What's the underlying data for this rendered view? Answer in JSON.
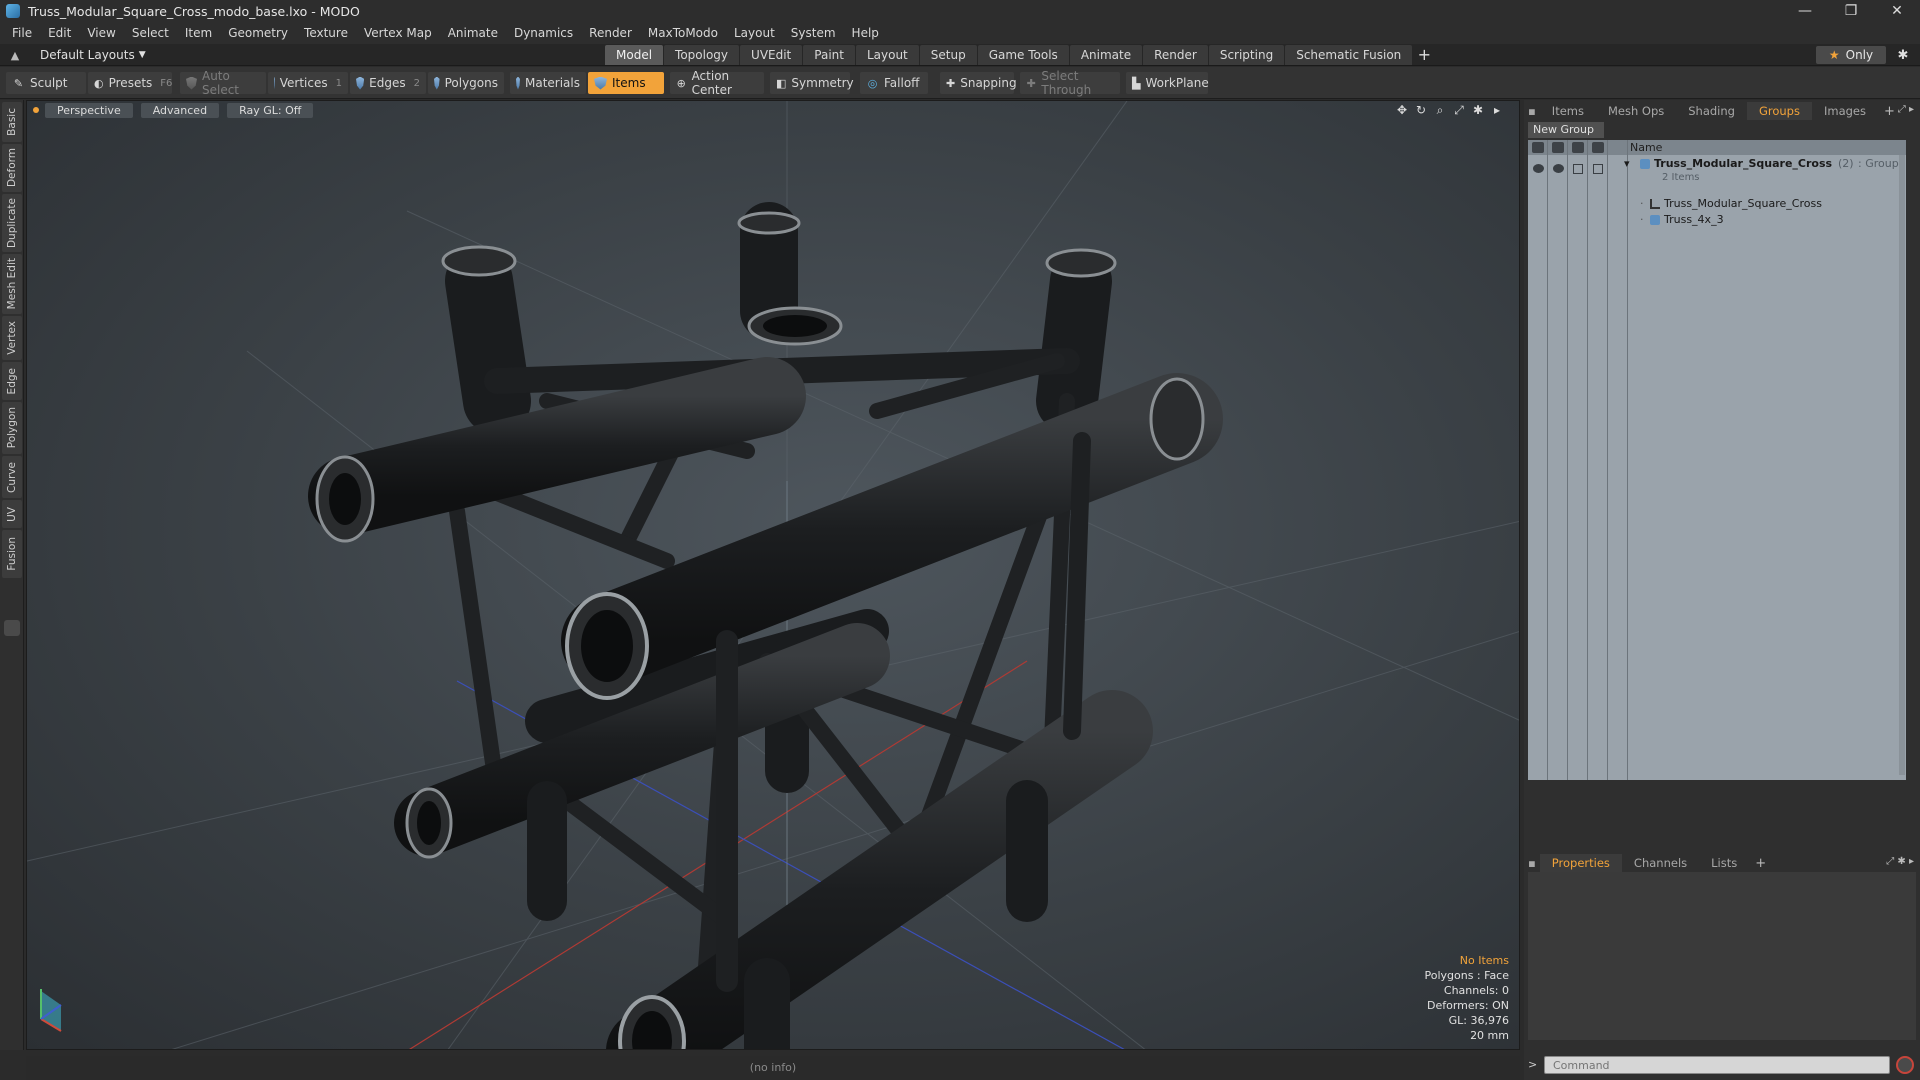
{
  "window": {
    "title": "Truss_Modular_Square_Cross_modo_base.lxo - MODO",
    "minimize": "—",
    "restore": "❐",
    "close": "✕"
  },
  "menu": [
    "File",
    "Edit",
    "View",
    "Select",
    "Item",
    "Geometry",
    "Texture",
    "Vertex Map",
    "Animate",
    "Dynamics",
    "Render",
    "MaxToModo",
    "Layout",
    "System",
    "Help"
  ],
  "layoutbar": {
    "layout_name": "Default Layouts",
    "tabs": [
      {
        "label": "Model",
        "active": true
      },
      {
        "label": "Topology",
        "active": false
      },
      {
        "label": "UVEdit",
        "active": false
      },
      {
        "label": "Paint",
        "active": false
      },
      {
        "label": "Layout",
        "active": false
      },
      {
        "label": "Setup",
        "active": false
      },
      {
        "label": "Game Tools",
        "active": false
      },
      {
        "label": "Animate",
        "active": false
      },
      {
        "label": "Render",
        "active": false
      },
      {
        "label": "Scripting",
        "active": false
      },
      {
        "label": "Schematic Fusion",
        "active": false
      }
    ],
    "only_label": "Only"
  },
  "toolbar": {
    "sculpt": "Sculpt",
    "presets": "Presets",
    "presets_key": "F6",
    "auto_select": "Auto Select",
    "vertices": "Vertices",
    "vertices_key": "1",
    "edges": "Edges",
    "edges_key": "2",
    "polygons": "Polygons",
    "materials": "Materials",
    "items": "Items",
    "action_center": "Action Center",
    "symmetry": "Symmetry",
    "falloff": "Falloff",
    "snapping": "Snapping",
    "select_through": "Select Through",
    "workplane": "WorkPlane"
  },
  "left_tabs": [
    "Basic",
    "Deform",
    "Duplicate",
    "Mesh Edit",
    "Vertex",
    "Edge",
    "Polygon",
    "Curve",
    "UV",
    "Fusion"
  ],
  "viewport": {
    "view_mode": "Perspective",
    "shading": "Advanced",
    "raygl": "Ray GL: Off",
    "info": {
      "selection": "No Items",
      "polygons": "Polygons : Face",
      "channels": "Channels: 0",
      "deformers": "Deformers: ON",
      "gl": "GL: 36,976",
      "scale": "20 mm"
    }
  },
  "statusbar": {
    "info": "(no info)"
  },
  "right_panel": {
    "tabs": [
      {
        "label": "Items",
        "active": false
      },
      {
        "label": "Mesh Ops",
        "active": false
      },
      {
        "label": "Shading",
        "active": false
      },
      {
        "label": "Groups",
        "active": true
      },
      {
        "label": "Images",
        "active": false
      }
    ],
    "new_group": "New Group",
    "column_name": "Name",
    "group": {
      "name": "Truss_Modular_Square_Cross",
      "count": "(2)",
      "type": ": Group",
      "items_count": "2 Items",
      "children": [
        "Truss_Modular_Square_Cross",
        "Truss_4x_3"
      ]
    },
    "bottom_tabs": [
      {
        "label": "Properties",
        "active": true
      },
      {
        "label": "Channels",
        "active": false
      },
      {
        "label": "Lists",
        "active": false
      }
    ],
    "command_placeholder": "Command"
  },
  "colors": {
    "accent": "#f2a33a",
    "panel": "#2f2f2f",
    "list_bg": "#9aa3ab"
  }
}
